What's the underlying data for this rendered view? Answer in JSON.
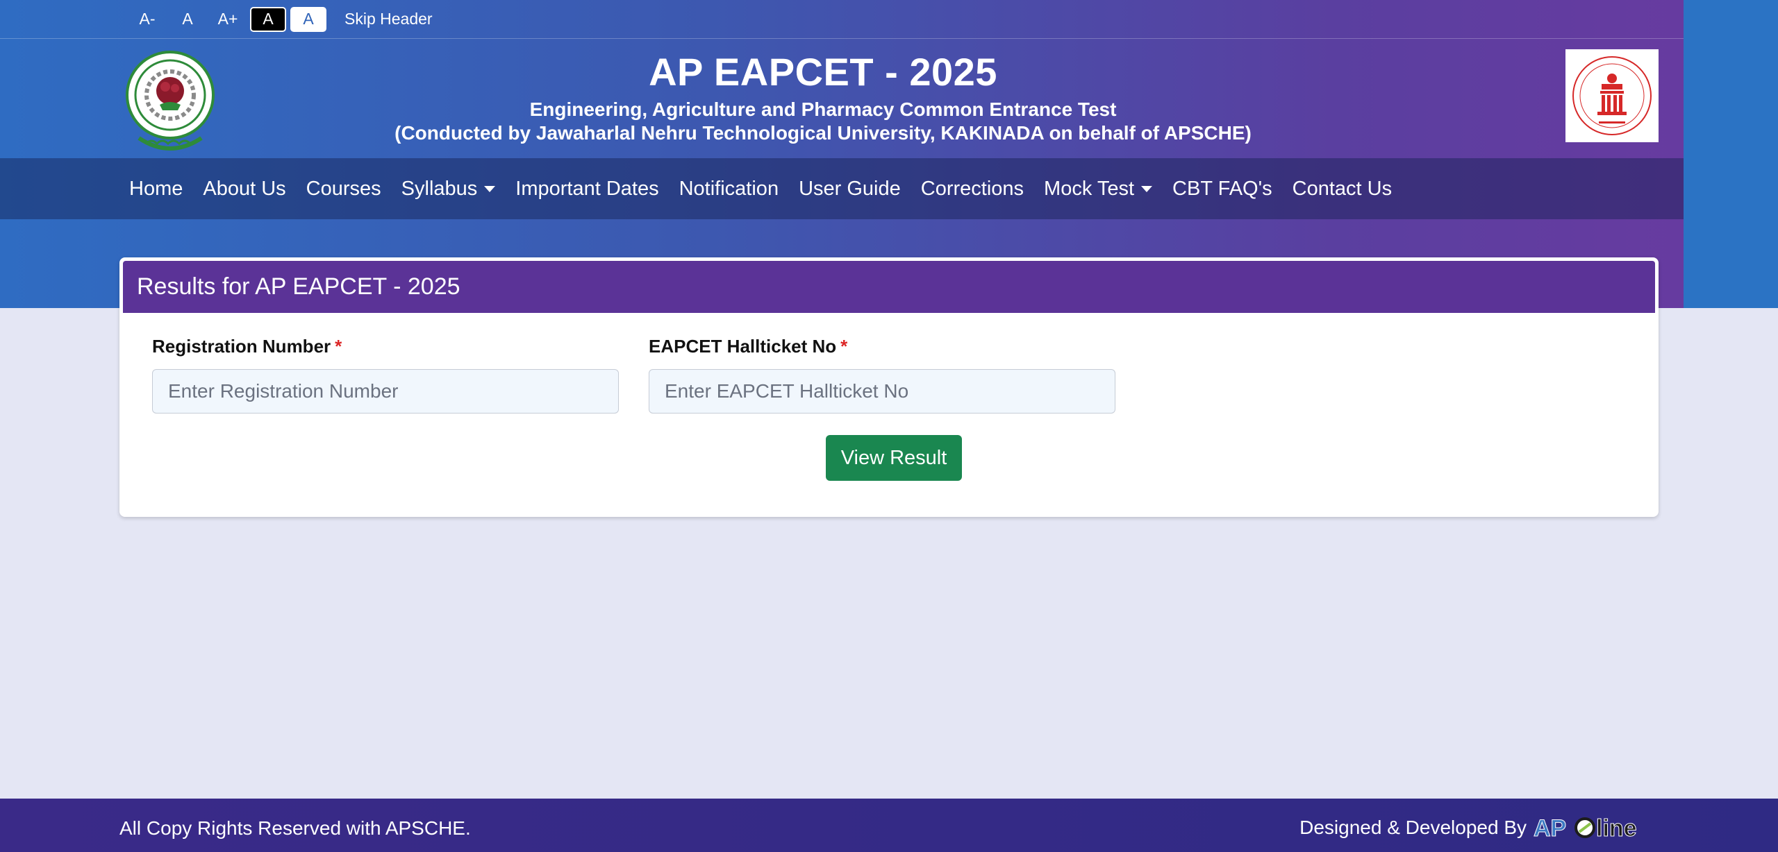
{
  "accessibility": {
    "decrease_font": "A-",
    "normal_font": "A",
    "increase_font": "A+",
    "dark_theme": "A",
    "light_theme": "A",
    "skip_header": "Skip Header"
  },
  "header": {
    "title": "AP EAPCET - 2025",
    "subtitle": "Engineering, Agriculture and Pharmacy Common Entrance Test",
    "subtitle2": "(Conducted by Jawaharlal Nehru Technological University, KAKINADA on behalf of APSCHE)",
    "logo_left_icon": "jntuk-emblem-icon",
    "logo_right_icon": "apsche-emblem-icon"
  },
  "nav": {
    "items": [
      {
        "label": "Home"
      },
      {
        "label": "About Us"
      },
      {
        "label": "Courses"
      },
      {
        "label": "Syllabus",
        "dropdown": true
      },
      {
        "label": "Important Dates"
      },
      {
        "label": "Notification"
      },
      {
        "label": "User Guide"
      },
      {
        "label": "Corrections"
      },
      {
        "label": "Mock Test",
        "dropdown": true
      },
      {
        "label": "CBT FAQ's"
      },
      {
        "label": "Contact Us"
      }
    ]
  },
  "results_card": {
    "title": "Results for AP EAPCET - 2025",
    "registration": {
      "label": "Registration Number",
      "required_marker": "*",
      "placeholder": "Enter Registration Number",
      "value": ""
    },
    "hallticket": {
      "label": "EAPCET Hallticket No",
      "required_marker": "*",
      "placeholder": "Enter EAPCET Hallticket No",
      "value": ""
    },
    "submit_label": "View Result"
  },
  "footer": {
    "copyright": "All Copy Rights Reserved with APSCHE.",
    "designed_by": "Designed & Developed By",
    "developer_logo": "APOnline"
  },
  "colors": {
    "header_gradient_start": "#2f6cc2",
    "header_gradient_end": "#6a3aa0",
    "card_header": "#5b3397",
    "submit_button": "#1a8750",
    "required_marker": "#dc2626",
    "page_background": "#e4e6f4"
  }
}
